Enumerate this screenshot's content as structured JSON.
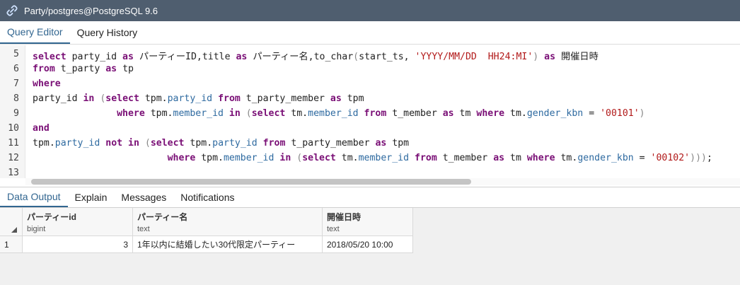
{
  "window": {
    "title": "Party/postgres@PostgreSQL 9.6"
  },
  "top_tabs": [
    {
      "label": "Query Editor",
      "active": true
    },
    {
      "label": "Query History",
      "active": false
    }
  ],
  "editor": {
    "line_numbers": [
      "5",
      "6",
      "7",
      "8",
      "9",
      "10",
      "11",
      "12",
      "13"
    ],
    "lines": [
      [
        [
          "kw",
          "select"
        ],
        [
          "t",
          " party_id "
        ],
        [
          "kw",
          "as"
        ],
        [
          "t",
          " パーティーID,title "
        ],
        [
          "kw",
          "as"
        ],
        [
          "t",
          " パーティー名,to_char"
        ],
        [
          "p",
          "("
        ],
        [
          "t",
          "start_ts, "
        ],
        [
          "s",
          "'YYYY/MM/DD  HH24:MI'"
        ],
        [
          "p",
          ")"
        ],
        [
          "t",
          " "
        ],
        [
          "kw",
          "as"
        ],
        [
          "t",
          " 開催日時"
        ]
      ],
      [
        [
          "kw",
          "from"
        ],
        [
          "t",
          " t_party "
        ],
        [
          "kw",
          "as"
        ],
        [
          "t",
          " tp"
        ]
      ],
      [
        [
          "kw",
          "where"
        ]
      ],
      [
        [
          "t",
          "party_id "
        ],
        [
          "kw",
          "in"
        ],
        [
          "t",
          " "
        ],
        [
          "p",
          "("
        ],
        [
          "kw",
          "select"
        ],
        [
          "t",
          " tpm."
        ],
        [
          "f",
          "party_id"
        ],
        [
          "t",
          " "
        ],
        [
          "kw",
          "from"
        ],
        [
          "t",
          " t_party_member "
        ],
        [
          "kw",
          "as"
        ],
        [
          "t",
          " tpm"
        ]
      ],
      [
        [
          "t",
          "               "
        ],
        [
          "kw",
          "where"
        ],
        [
          "t",
          " tpm."
        ],
        [
          "f",
          "member_id"
        ],
        [
          "t",
          " "
        ],
        [
          "kw",
          "in"
        ],
        [
          "t",
          " "
        ],
        [
          "p",
          "("
        ],
        [
          "kw",
          "select"
        ],
        [
          "t",
          " tm."
        ],
        [
          "f",
          "member_id"
        ],
        [
          "t",
          " "
        ],
        [
          "kw",
          "from"
        ],
        [
          "t",
          " t_member "
        ],
        [
          "kw",
          "as"
        ],
        [
          "t",
          " tm "
        ],
        [
          "kw",
          "where"
        ],
        [
          "t",
          " tm."
        ],
        [
          "f",
          "gender_kbn"
        ],
        [
          "t",
          " = "
        ],
        [
          "s",
          "'00101'"
        ],
        [
          "p",
          ")"
        ]
      ],
      [
        [
          "kw",
          "and"
        ]
      ],
      [
        [
          "t",
          "tpm."
        ],
        [
          "f",
          "party_id"
        ],
        [
          "t",
          " "
        ],
        [
          "kw",
          "not"
        ],
        [
          "t",
          " "
        ],
        [
          "kw",
          "in"
        ],
        [
          "t",
          " "
        ],
        [
          "p",
          "("
        ],
        [
          "kw",
          "select"
        ],
        [
          "t",
          " tpm."
        ],
        [
          "f",
          "party_id"
        ],
        [
          "t",
          " "
        ],
        [
          "kw",
          "from"
        ],
        [
          "t",
          " t_party_member "
        ],
        [
          "kw",
          "as"
        ],
        [
          "t",
          " tpm"
        ]
      ],
      [
        [
          "t",
          "                        "
        ],
        [
          "kw",
          "where"
        ],
        [
          "t",
          " tpm."
        ],
        [
          "f",
          "member_id"
        ],
        [
          "t",
          " "
        ],
        [
          "kw",
          "in"
        ],
        [
          "t",
          " "
        ],
        [
          "p",
          "("
        ],
        [
          "kw",
          "select"
        ],
        [
          "t",
          " tm."
        ],
        [
          "f",
          "member_id"
        ],
        [
          "t",
          " "
        ],
        [
          "kw",
          "from"
        ],
        [
          "t",
          " t_member "
        ],
        [
          "kw",
          "as"
        ],
        [
          "t",
          " tm "
        ],
        [
          "kw",
          "where"
        ],
        [
          "t",
          " tm."
        ],
        [
          "f",
          "gender_kbn"
        ],
        [
          "t",
          " = "
        ],
        [
          "s",
          "'00102'"
        ],
        [
          "p",
          ")))"
        ],
        [
          "t",
          ";"
        ]
      ],
      []
    ]
  },
  "output_tabs": [
    {
      "label": "Data Output",
      "active": true
    },
    {
      "label": "Explain",
      "active": false
    },
    {
      "label": "Messages",
      "active": false
    },
    {
      "label": "Notifications",
      "active": false
    }
  ],
  "result_grid": {
    "columns": [
      {
        "name": "パーティーid",
        "type": "bigint"
      },
      {
        "name": "パーティー名",
        "type": "text"
      },
      {
        "name": "開催日時",
        "type": "text"
      }
    ],
    "rows": [
      {
        "row_number": "1",
        "cells": [
          "3",
          "1年以内に結婚したい30代限定パーティー",
          "2018/05/20  10:00"
        ]
      }
    ]
  }
}
